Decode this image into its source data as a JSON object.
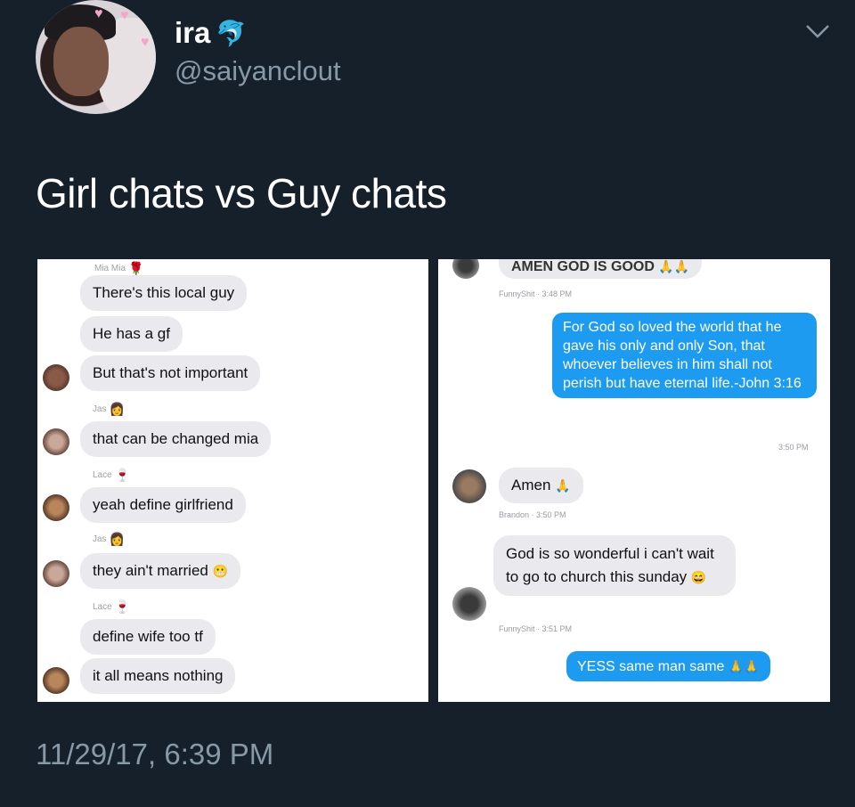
{
  "profile": {
    "name": "ira",
    "handle": "@saiyanclout",
    "badge_icon": "dolphin-icon"
  },
  "tweet": {
    "text": "Girl chats vs Guy chats",
    "timestamp": "11/29/17, 6:39 PM"
  },
  "left_chat": {
    "sender_top": "Mia Mia",
    "messages": [
      {
        "text": "There's this local guy"
      },
      {
        "text": "He has a gf"
      },
      {
        "text": "But that's not important"
      },
      {
        "sender": "Jas",
        "text": "that can be changed mia"
      },
      {
        "sender": "Lace",
        "text": "yeah define girlfriend"
      },
      {
        "sender": "Jas",
        "text": "they ain't married"
      },
      {
        "sender": "Lace",
        "text": "define wife too tf"
      },
      {
        "text": "it all means nothing"
      }
    ]
  },
  "right_chat": {
    "top_text": "AMEN GOD IS GOOD",
    "top_meta": "FunnyShit · 3:48 PM",
    "blue1": "For God so loved the world that he gave his only and only Son, that whoever believes in him shall not perish but have eternal life.-John 3:16",
    "blue1_time": "3:50 PM",
    "amen": "Amen",
    "amen_meta": "Brandon · 3:50 PM",
    "wonderful": "God is so wonderful i can't wait to go to church this sunday",
    "wonderful_meta": "FunnyShit · 3:51 PM",
    "blue2": "YESS same man same"
  },
  "colors": {
    "background": "#15202b",
    "handle_gray": "#8899a6",
    "imessage_blue": "#1d9bf0",
    "bubble_gray": "#e9e9ee"
  }
}
